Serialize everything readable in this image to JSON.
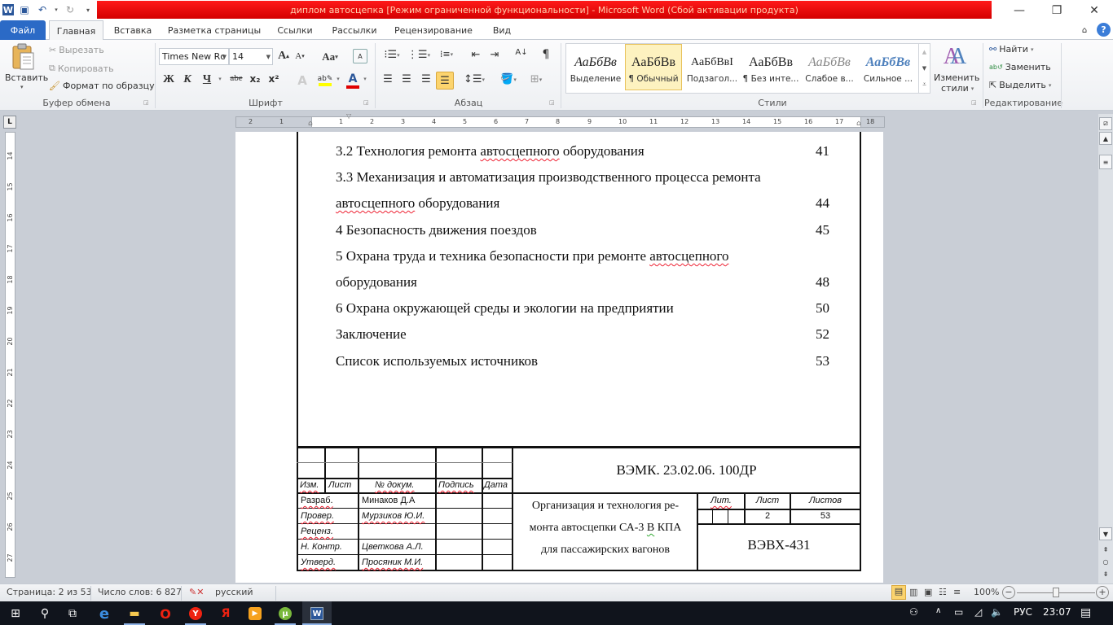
{
  "app": {
    "title": "диплом автосцепка [Режим ограниченной функциональности]  -  Microsoft Word (Сбой активации продукта)",
    "title_bar_color": "#e00000"
  },
  "window_controls": {
    "minimize": "—",
    "restore": "❐",
    "close": "✕"
  },
  "quick_access": [
    {
      "name": "word-logo-icon",
      "glyph": "W"
    },
    {
      "name": "save-icon",
      "glyph": "💾"
    },
    {
      "name": "undo-icon",
      "glyph": "↶"
    },
    {
      "name": "redo-icon",
      "glyph": "↻"
    },
    {
      "name": "customize-icon",
      "glyph": "▾"
    }
  ],
  "tabs": [
    {
      "label": "Файл",
      "active": false
    },
    {
      "label": "Главная",
      "active": true
    },
    {
      "label": "Вставка",
      "active": false
    },
    {
      "label": "Разметка страницы",
      "active": false
    },
    {
      "label": "Ссылки",
      "active": false
    },
    {
      "label": "Рассылки",
      "active": false
    },
    {
      "label": "Рецензирование",
      "active": false
    },
    {
      "label": "Вид",
      "active": false
    }
  ],
  "ribbon": {
    "clipboard": {
      "label": "Буфер обмена",
      "paste": "Вставить",
      "cut": "Вырезать",
      "copy": "Копировать",
      "format_painter": "Формат по образцу"
    },
    "font": {
      "label": "Шрифт",
      "font_name": "Times New Rc",
      "font_size": "14",
      "grow": "A",
      "shrink": "A",
      "case": "Aa",
      "bold": "Ж",
      "italic": "К",
      "underline": "Ч",
      "strike": "abe",
      "subscript": "x₂",
      "superscript": "x²",
      "highlight_color": "#ffff00",
      "font_color": "#e00000"
    },
    "paragraph": {
      "label": "Абзац"
    },
    "styles": {
      "label": "Стили",
      "items": [
        {
          "sample": "АаБбВв",
          "name": "Выделение",
          "selected": false
        },
        {
          "sample": "АаБбВв",
          "name": "¶ Обычный",
          "selected": true
        },
        {
          "sample": "АаБбВвI",
          "name": "Подзагол...",
          "selected": false
        },
        {
          "sample": "АаБбВв",
          "name": "¶ Без инте...",
          "selected": false
        },
        {
          "sample": "АаБбВв",
          "name": "Слабое в...",
          "selected": false
        },
        {
          "sample": "АаБбВв",
          "name": "Сильное ...",
          "selected": false
        }
      ],
      "change_styles_1": "Изменить",
      "change_styles_2": "стили"
    },
    "editing": {
      "label": "Редактирование",
      "find": "Найти",
      "replace": "Заменить",
      "select": "Выделить"
    }
  },
  "ruler": {
    "h_numbers": [
      "2",
      "1",
      "1",
      "2",
      "3",
      "4",
      "5",
      "6",
      "7",
      "8",
      "9",
      "10",
      "11",
      "12",
      "13",
      "14",
      "15",
      "16",
      "17",
      "18"
    ],
    "v_numbers": [
      "14",
      "15",
      "16",
      "17",
      "18",
      "19",
      "20",
      "21",
      "22",
      "23",
      "24",
      "25",
      "26",
      "27"
    ]
  },
  "document": {
    "toc": [
      {
        "text": "3.2 Технология ремонта ",
        "squig": "автосцепного",
        "after": " оборудования",
        "page": "41"
      },
      {
        "text": "3.3 Механизация и автоматизация производственного процесса ремонта",
        "page": ""
      },
      {
        "text": "",
        "squig": "автосцепного",
        "after": " оборудования",
        "page": "44"
      },
      {
        "text": "4 Безопасность движения поездов",
        "page": "45"
      },
      {
        "text": "5 Охрана труда и техника безопасности при ремонте ",
        "squig": "автосцепного",
        "after": "",
        "page": ""
      },
      {
        "text": "оборудования",
        "page": "48"
      },
      {
        "text": "6 Охрана окружающей среды и экологии на предприятии",
        "page": "50"
      },
      {
        "text": "Заключение",
        "page": "52"
      },
      {
        "text": "Список используемых источников",
        "page": "53"
      }
    ],
    "stamp": {
      "headers": [
        "Изм.",
        "Лист",
        "№ докум.",
        "Подпись",
        "Дата"
      ],
      "rows": [
        {
          "role": "Разраб.",
          "name": "Минаков Д.А"
        },
        {
          "role": "Провер.",
          "name": "Мурзиков Ю.И."
        },
        {
          "role": "Реценз.",
          "name": ""
        },
        {
          "role": "Н. Контр.",
          "name": "Цветкова А.Л."
        },
        {
          "role": "Утверд.",
          "name": "Просяник М.И."
        }
      ],
      "code": "ВЭМК. 23.02.06. 100ДР",
      "title_1": "Организация и технология ре-",
      "title_2a": "монта автосцепки СА-3 ",
      "title_2b": "В",
      "title_2c": " КПА",
      "title_3": "для пассажирских вагонов",
      "lit_label": "Лит.",
      "sheet_label": "Лист",
      "sheets_label": "Листов",
      "sheet": "2",
      "sheets": "53",
      "group": "ВЭВХ-431"
    }
  },
  "status_bar": {
    "page": "Страница: 2 из 53",
    "words": "Число слов: 6 827",
    "language": "русский",
    "zoom": "100%",
    "zoom_level_percent": 100
  },
  "taskbar": {
    "apps": [
      {
        "name": "start-icon",
        "glyph": "⊞"
      },
      {
        "name": "search-icon",
        "glyph": "⚲"
      },
      {
        "name": "task-view-icon",
        "glyph": "⧉"
      },
      {
        "name": "edge-icon",
        "glyph": "e"
      },
      {
        "name": "explorer-icon",
        "glyph": "▬"
      },
      {
        "name": "opera-icon",
        "glyph": "O"
      },
      {
        "name": "yandex-browser-icon",
        "glyph": "Y"
      },
      {
        "name": "yandex-icon",
        "glyph": "Я"
      },
      {
        "name": "media-player-icon",
        "glyph": "▶"
      },
      {
        "name": "utorrent-icon",
        "glyph": "µ"
      },
      {
        "name": "word-icon",
        "glyph": "W"
      }
    ],
    "language": "РУС",
    "time": "23:07"
  }
}
